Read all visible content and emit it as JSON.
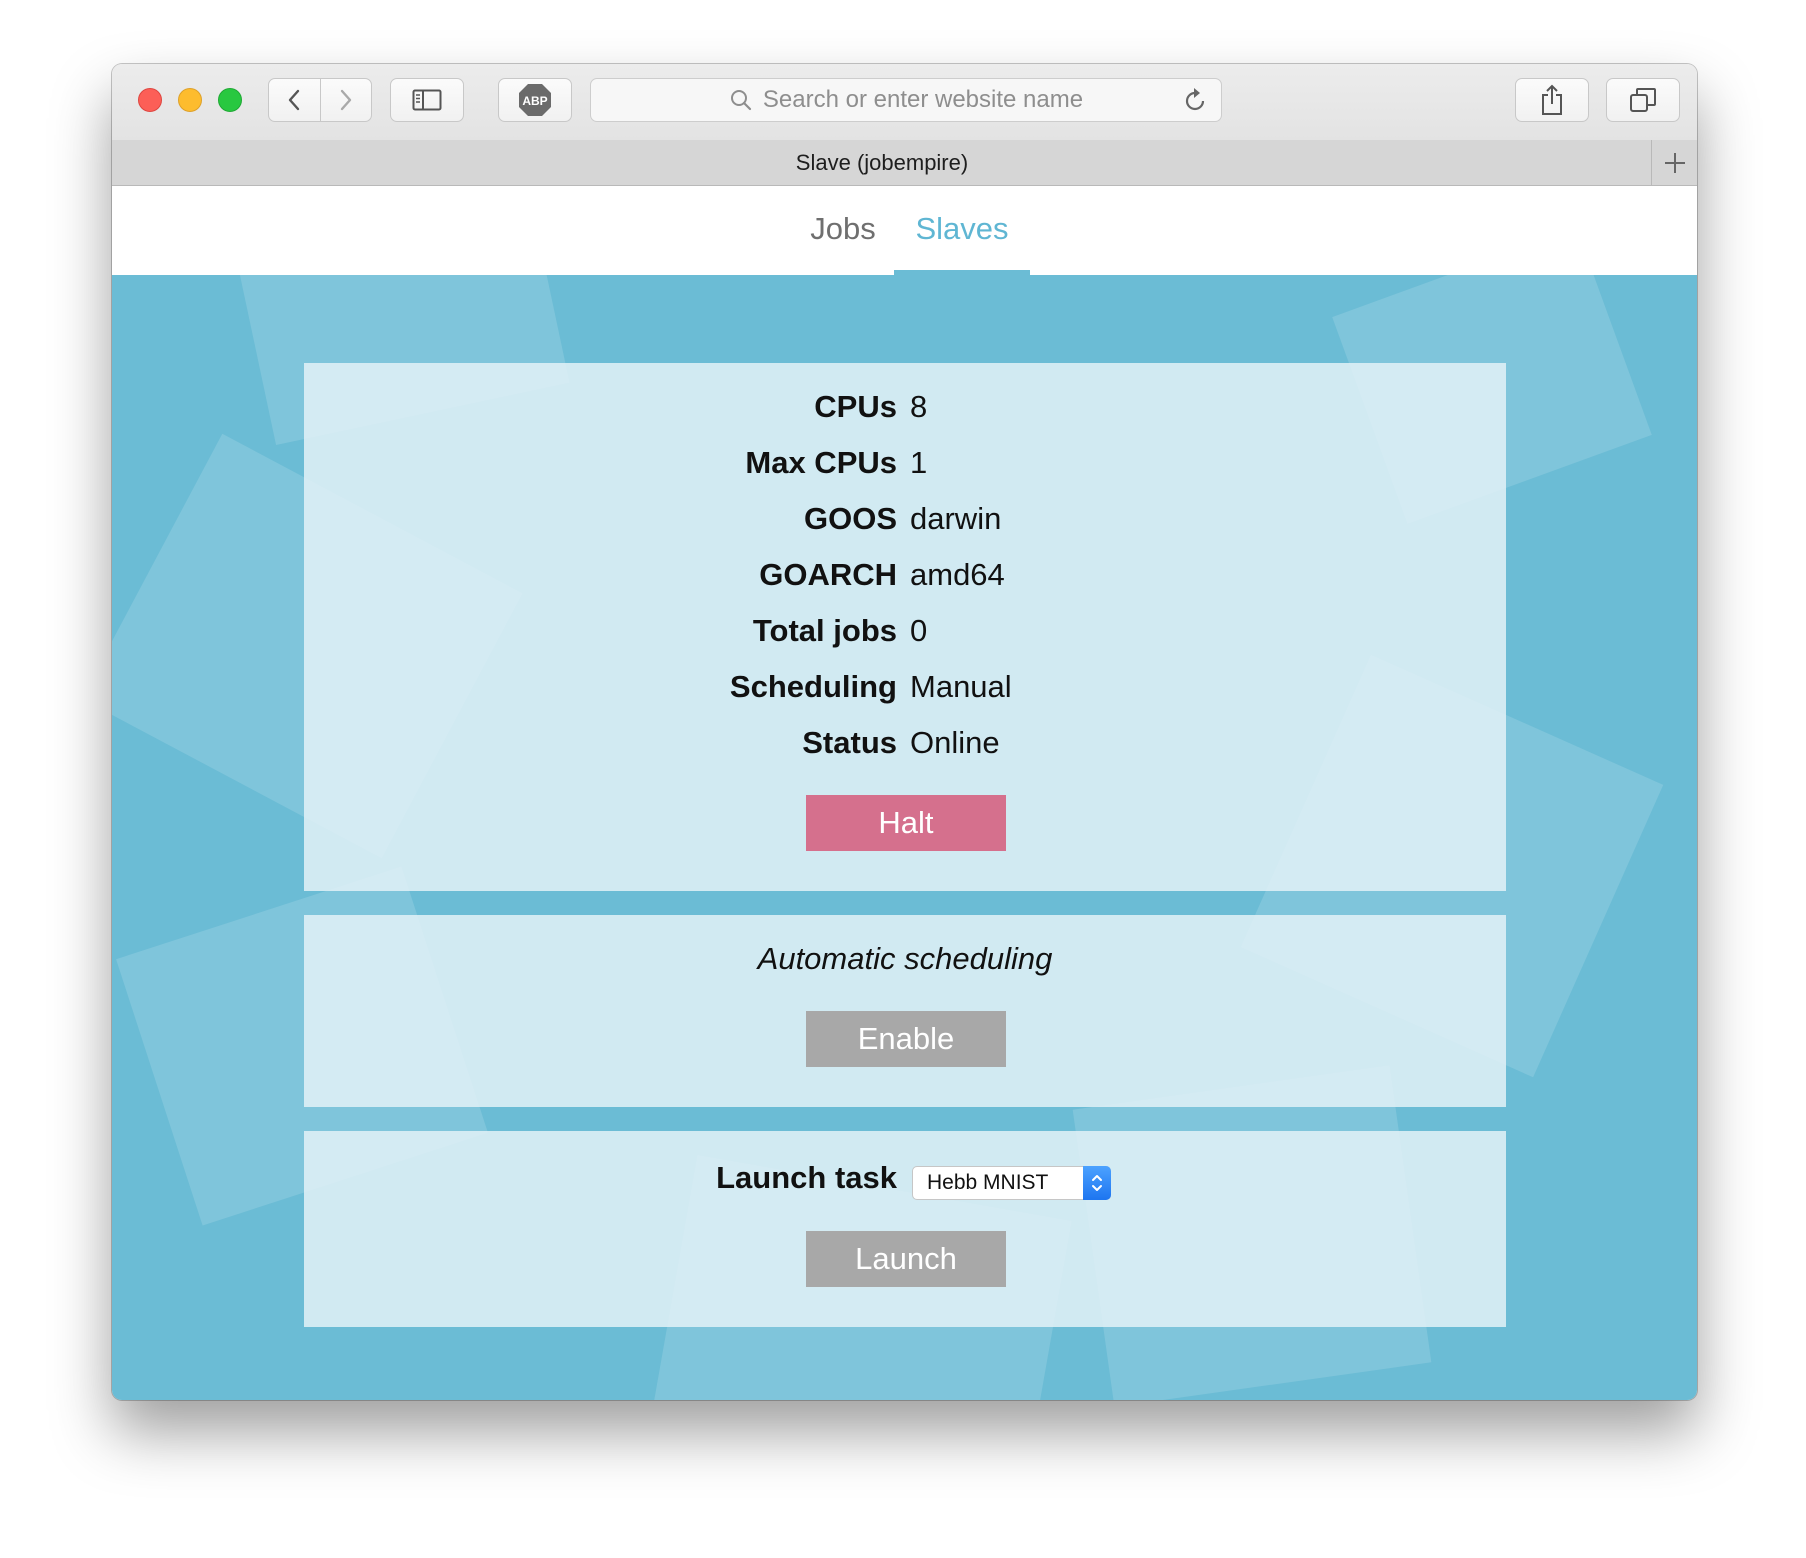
{
  "browser": {
    "url_placeholder": "Search or enter website name",
    "tab_title": "Slave (jobempire)",
    "adblock_label": "ABP",
    "icons": [
      "chevron-left-icon",
      "chevron-right-icon",
      "sidebar-icon",
      "adblock-icon",
      "search-icon",
      "reload-icon",
      "share-icon",
      "tabs-icon",
      "plus-icon"
    ]
  },
  "nav": {
    "jobs_label": "Jobs",
    "slaves_label": "Slaves",
    "active": "Slaves"
  },
  "info": {
    "rows": [
      {
        "label": "CPUs",
        "value": "8"
      },
      {
        "label": "Max CPUs",
        "value": "1"
      },
      {
        "label": "GOOS",
        "value": "darwin"
      },
      {
        "label": "GOARCH",
        "value": "amd64"
      },
      {
        "label": "Total jobs",
        "value": "0"
      },
      {
        "label": "Scheduling",
        "value": "Manual"
      },
      {
        "label": "Status",
        "value": "Online"
      }
    ],
    "halt_label": "Halt"
  },
  "auto": {
    "title": "Automatic scheduling",
    "enable_label": "Enable"
  },
  "launch": {
    "label": "Launch task",
    "selected_task": "Hebb MNIST",
    "launch_label": "Launch"
  },
  "colors": {
    "accent": "#5fb6d3",
    "page_bg": "#6bbcd5",
    "halt": "#d5708d",
    "disabled": "#a8a8a8",
    "select_arrow": "#1d75f0"
  }
}
